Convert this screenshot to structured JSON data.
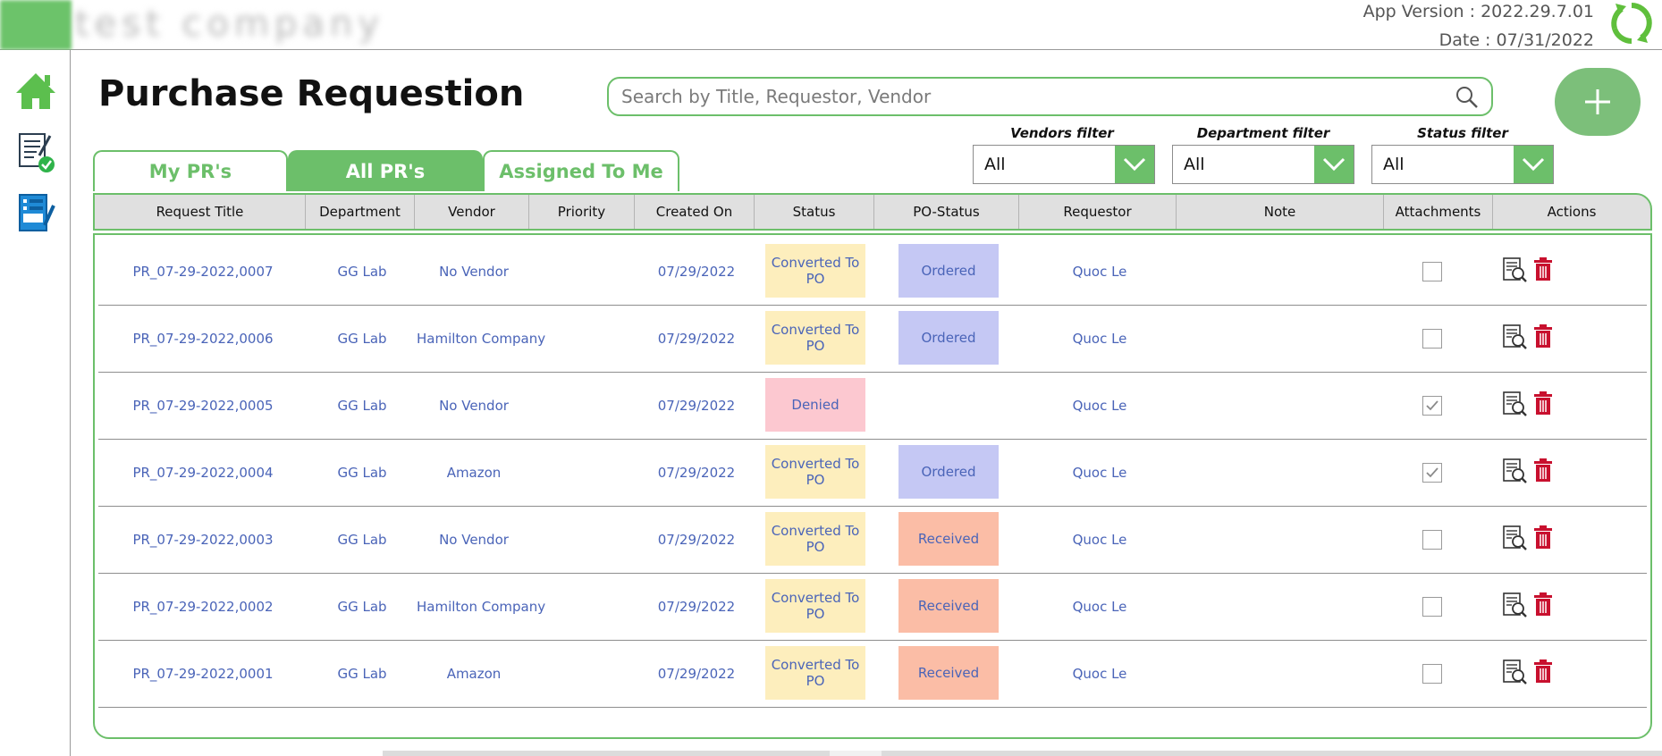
{
  "header": {
    "company_name": "test company",
    "app_version": "App Version : 2022.29.7.01",
    "date": "Date : 07/31/2022"
  },
  "page": {
    "title": "Purchase Requestion"
  },
  "search": {
    "placeholder": "Search by Title, Requestor, Vendor",
    "value": ""
  },
  "tabs": [
    {
      "label": "My PR's",
      "active": false
    },
    {
      "label": "All PR's",
      "active": true
    },
    {
      "label": "Assigned To Me",
      "active": false
    }
  ],
  "filters": {
    "vendors": {
      "label": "Vendors filter",
      "value": "All"
    },
    "department": {
      "label": "Department filter",
      "value": "All"
    },
    "status": {
      "label": "Status filter",
      "value": "All"
    }
  },
  "table": {
    "columns": [
      "Request Title",
      "Department",
      "Vendor",
      "Priority",
      "Created On",
      "Status",
      "PO-Status",
      "Requestor",
      "Note",
      "Attachments",
      "Actions"
    ],
    "rows": [
      {
        "title": "PR_07-29-2022,0007",
        "department": "GG Lab",
        "vendor": "No Vendor",
        "priority": "",
        "created_on": "07/29/2022",
        "status": "Converted To PO",
        "status_color": "#fdeebd",
        "po_status": "Ordered",
        "po_color": "#c5c8f4",
        "requestor": "Quoc Le",
        "note": "",
        "attachment": false
      },
      {
        "title": "PR_07-29-2022,0006",
        "department": "GG Lab",
        "vendor": "Hamilton Company",
        "priority": "",
        "created_on": "07/29/2022",
        "status": "Converted To PO",
        "status_color": "#fdeebd",
        "po_status": "Ordered",
        "po_color": "#c5c8f4",
        "requestor": "Quoc Le",
        "note": "",
        "attachment": false
      },
      {
        "title": "PR_07-29-2022,0005",
        "department": "GG Lab",
        "vendor": "No Vendor",
        "priority": "",
        "created_on": "07/29/2022",
        "status": "Denied",
        "status_color": "#fcc8d0",
        "po_status": "",
        "po_color": "",
        "requestor": "Quoc Le",
        "note": "",
        "attachment": true
      },
      {
        "title": "PR_07-29-2022,0004",
        "department": "GG Lab",
        "vendor": "Amazon",
        "priority": "",
        "created_on": "07/29/2022",
        "status": "Converted To PO",
        "status_color": "#fdeebd",
        "po_status": "Ordered",
        "po_color": "#c5c8f4",
        "requestor": "Quoc Le",
        "note": "",
        "attachment": true
      },
      {
        "title": "PR_07-29-2022,0003",
        "department": "GG Lab",
        "vendor": "No Vendor",
        "priority": "",
        "created_on": "07/29/2022",
        "status": "Converted To PO",
        "status_color": "#fdeebd",
        "po_status": "Received",
        "po_color": "#fbbda6",
        "requestor": "Quoc Le",
        "note": "",
        "attachment": false
      },
      {
        "title": "PR_07-29-2022,0002",
        "department": "GG Lab",
        "vendor": "Hamilton Company",
        "priority": "",
        "created_on": "07/29/2022",
        "status": "Converted To PO",
        "status_color": "#fdeebd",
        "po_status": "Received",
        "po_color": "#fbbda6",
        "requestor": "Quoc Le",
        "note": "",
        "attachment": false
      },
      {
        "title": "PR_07-29-2022,0001",
        "department": "GG Lab",
        "vendor": "Amazon",
        "priority": "",
        "created_on": "07/29/2022",
        "status": "Converted To PO",
        "status_color": "#fdeebd",
        "po_status": "Received",
        "po_color": "#fbbda6",
        "requestor": "Quoc Le",
        "note": "",
        "attachment": false
      }
    ]
  },
  "icons": {
    "refresh": "refresh-icon",
    "nav_home": "home-icon",
    "nav_approvals": "document-check-icon",
    "nav_forms": "form-edit-icon",
    "search": "search-icon",
    "add": "plus-icon",
    "dropdown": "chevron-down-icon",
    "view": "view-document-icon",
    "delete": "trash-icon",
    "check": "checkmark-icon"
  },
  "colors": {
    "accent": "#6cbf6a",
    "link_text": "#4a64b8",
    "delete": "#c8102e",
    "status_converted": "#fdeebd",
    "status_denied": "#fcc8d0",
    "po_ordered": "#c5c8f4",
    "po_received": "#fbbda6"
  }
}
